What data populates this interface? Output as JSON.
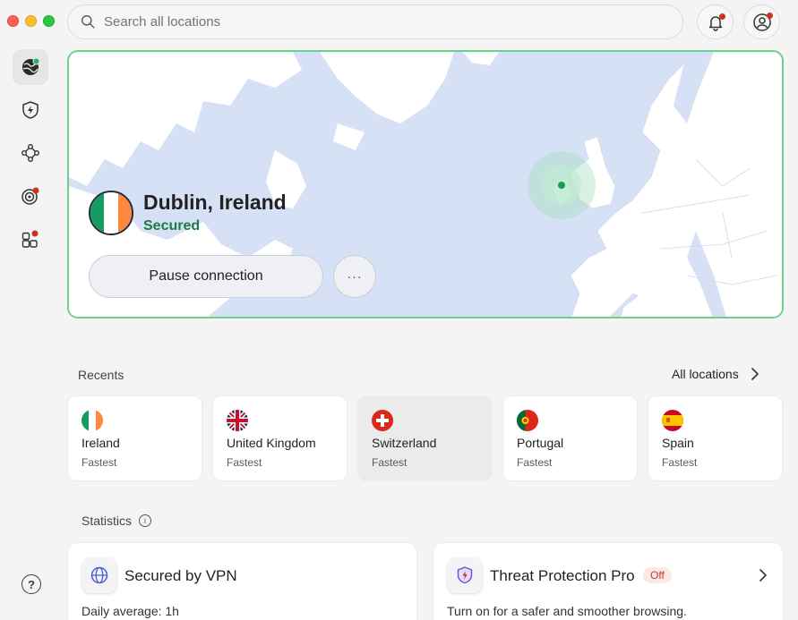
{
  "window": {
    "traffic_lights": [
      "close",
      "minimize",
      "maximize"
    ]
  },
  "search": {
    "placeholder": "Search all locations",
    "icon": "search-icon"
  },
  "header": {
    "notifications_icon": "bell-icon",
    "account_icon": "user-icon",
    "badge_color": "#c8341e"
  },
  "sidebar": {
    "items": [
      {
        "name": "globe-icon",
        "active": true
      },
      {
        "name": "threat-protection-icon",
        "active": false
      },
      {
        "name": "meshnet-icon",
        "active": false
      },
      {
        "name": "dark-web-monitor-icon",
        "active": false
      },
      {
        "name": "apps-icon",
        "active": false
      }
    ],
    "help_label": "?"
  },
  "connection": {
    "city": "Dublin, Ireland",
    "status": "Secured",
    "pause_label": "Pause connection",
    "more_label": "···",
    "status_color": "#1d7a45",
    "border_color": "#6fcf8e"
  },
  "recents": {
    "label": "Recents",
    "all_locations": "All locations",
    "items": [
      {
        "country": "Ireland",
        "server": "Fastest",
        "flag": "ie"
      },
      {
        "country": "United Kingdom",
        "server": "Fastest",
        "flag": "gb"
      },
      {
        "country": "Switzerland",
        "server": "Fastest",
        "flag": "ch"
      },
      {
        "country": "Portugal",
        "server": "Fastest",
        "flag": "pt"
      },
      {
        "country": "Spain",
        "server": "Fastest",
        "flag": "es"
      }
    ]
  },
  "statistics": {
    "label": "Statistics",
    "info": "i",
    "vpn": {
      "title": "Secured by VPN",
      "daily_label": "Daily average: ",
      "daily_value": "1h"
    },
    "threat": {
      "title": "Threat Protection Pro",
      "badge": "Off",
      "description": "Turn on for a safer and smoother browsing."
    }
  }
}
